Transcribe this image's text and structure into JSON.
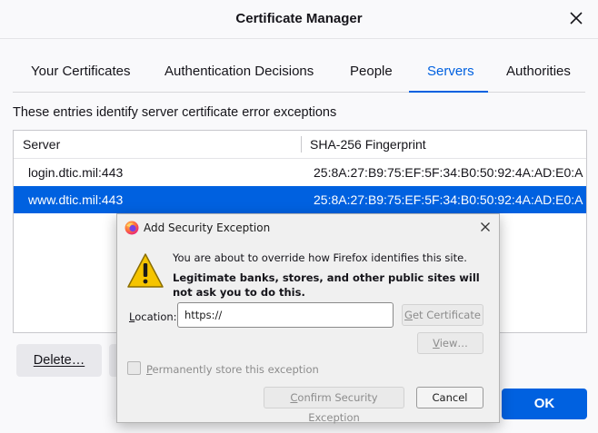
{
  "window": {
    "title": "Certificate Manager"
  },
  "tabs": [
    {
      "label": "Your Certificates"
    },
    {
      "label": "Authentication Decisions"
    },
    {
      "label": "People"
    },
    {
      "label": "Servers"
    },
    {
      "label": "Authorities"
    }
  ],
  "selected_tab": "Servers",
  "description": "These entries identify server certificate error exceptions",
  "table": {
    "columns": [
      "Server",
      "SHA-256 Fingerprint"
    ],
    "rows": [
      {
        "server": "login.dtic.mil:443",
        "fingerprint": "25:8A:27:B9:75:EF:5F:34:B0:50:92:4A:AD:E0:A…"
      },
      {
        "server": "www.dtic.mil:443",
        "fingerprint": "25:8A:27:B9:75:EF:5F:34:B0:50:92:4A:AD:E0:A…"
      }
    ],
    "selected_row": 1
  },
  "buttons": {
    "delete": "Delete…",
    "ok": "OK"
  },
  "dialog": {
    "title": "Add Security Exception",
    "message": "You are about to override how Firefox identifies this site.",
    "warning": "Legitimate banks, stores, and other public sites will not ask you to do this.",
    "location_label": "Location:",
    "location_value": "https://",
    "get_certificate": "Get Certificate",
    "view": "View…",
    "permanent_label": "Permanently store this exception",
    "confirm": "Confirm Security Exception",
    "cancel": "Cancel"
  },
  "colors": {
    "accent": "#0061e0",
    "warning_yellow": "#f5c400"
  }
}
